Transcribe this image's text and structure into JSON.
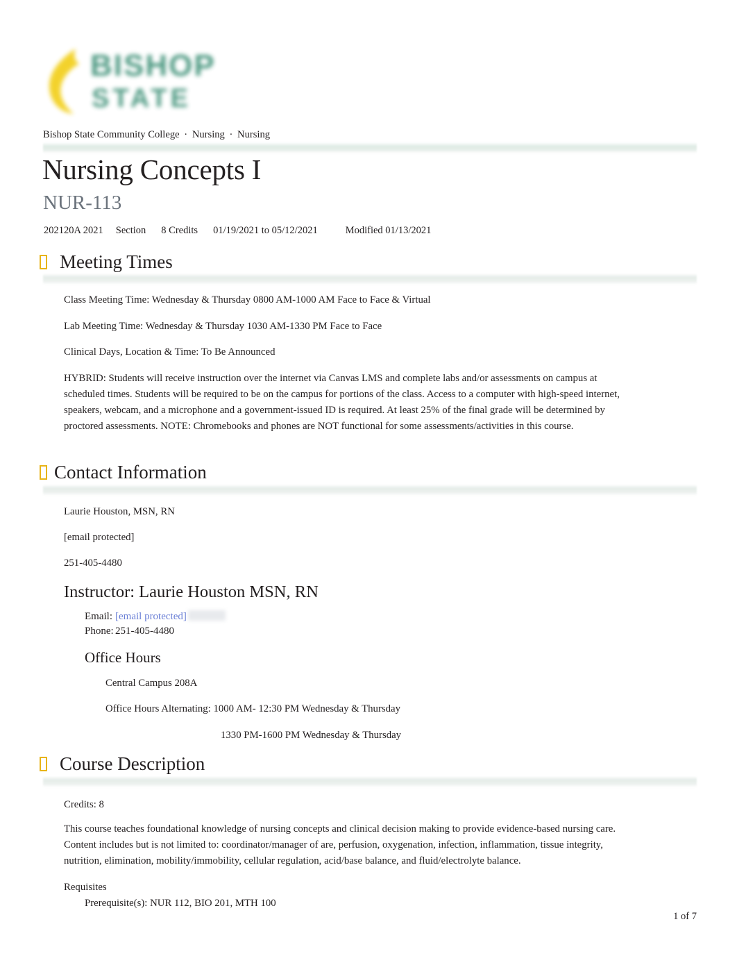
{
  "header": {
    "logo": {
      "word_top": "BISHOP",
      "word_bottom": "STATE",
      "green": "#3f9178",
      "yellow": "#f2cf1b"
    },
    "breadcrumb": {
      "institution": "Bishop State Community College",
      "department": "Nursing",
      "program": "Nursing",
      "separator": "·"
    }
  },
  "course": {
    "title": "Nursing Concepts I",
    "code": "NUR-113",
    "meta": {
      "term": "202120A 2021",
      "section": "Section",
      "credits": "8 Credits",
      "dates": "01/19/2021 to 05/12/2021",
      "modified": "Modified 01/13/2021"
    }
  },
  "sections": {
    "meeting_times": {
      "heading": "Meeting Times",
      "icon": "missing-glyph-box-icon",
      "class_time": "Class Meeting Time: Wednesday & Thursday 0800 AM-1000 AM Face to Face & Virtual",
      "lab_time": "Lab Meeting Time: Wednesday & Thursday 1030 AM-1330 PM Face to Face",
      "clinical": "Clinical Days, Location & Time: To Be Announced",
      "hybrid_note": "HYBRID: Students will receive instruction over the internet via Canvas LMS and complete labs and/or assessments on campus at scheduled times. Students will be required to be on the campus for portions of the class. Access to a computer with high-speed internet, speakers, webcam, and a microphone and a government-issued ID is required. At least 25% of the final grade will be determined by proctored assessments. NOTE: Chromebooks and phones are NOT functional for some assessments/activities in this course."
    },
    "contact_information": {
      "heading": "Contact Information",
      "icon": "missing-glyph-box-icon",
      "name": "Laurie Houston, MSN, RN",
      "email_masked": "[email protected]",
      "phone": "251-405-4480",
      "instructor_heading": "Instructor: Laurie Houston MSN, RN",
      "email_label": "Email:",
      "email_link": "[email protected]",
      "phone_label": "Phone:",
      "phone_value": "251-405-4480",
      "office_hours": {
        "heading": "Office Hours",
        "location": "Central Campus 208A",
        "line1": "Office Hours Alternating: 1000 AM- 12:30 PM Wednesday & Thursday",
        "line2": "1330 PM-1600 PM Wednesday & Thursday"
      }
    },
    "course_description": {
      "heading": "Course Description",
      "icon": "missing-glyph-box-icon",
      "credits": "Credits: 8",
      "description": "This course teaches foundational knowledge of nursing concepts and clinical decision making to provide evidence-based nursing care. Content includes but is not limited to: coordinator/manager of are, perfusion, oxygenation, infection, inflammation, tissue integrity, nutrition, elimination, mobility/immobility, cellular regulation, acid/base balance, and fluid/electrolyte balance.",
      "requisites_label": "Requisites",
      "prerequisites": "Prerequisite(s): NUR 112, BIO 201, MTH 100"
    }
  },
  "footer": {
    "page_indicator": "1 of 7"
  }
}
